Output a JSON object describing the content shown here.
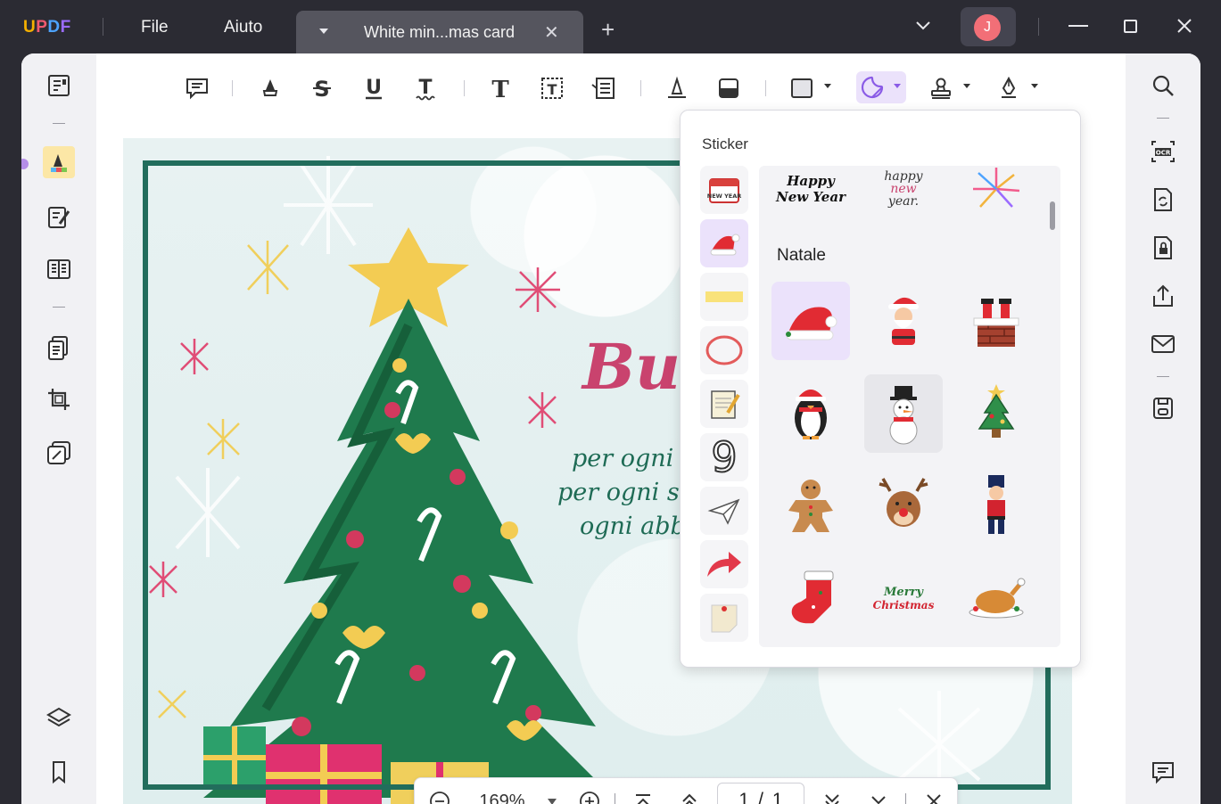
{
  "app": {
    "logo": [
      "U",
      "P",
      "D",
      "F"
    ],
    "logo_colors": [
      "#f5b000",
      "#ef5a6f",
      "#4da3ff",
      "#9b6bff"
    ],
    "menu": {
      "file": "File",
      "help": "Aiuto"
    },
    "tab": {
      "title": "White min...mas card",
      "close": "✕"
    },
    "new_tab": "+",
    "avatar_letter": "J",
    "window": {
      "dropdown": "⌄",
      "minimize": "—",
      "maximize": "☐",
      "close": "✕"
    }
  },
  "card": {
    "title_partial": "Bu",
    "lines": [
      "per ogni c",
      "per ogni son",
      "ogni abbr"
    ]
  },
  "zoom": {
    "value": "169%",
    "current_page": "1",
    "separator": "/",
    "total_pages": "1"
  },
  "sticker_panel": {
    "title": "Sticker",
    "section": "Natale",
    "top_row": [
      {
        "name": "happy-new-year-banner",
        "text_a": "Happy",
        "text_b": "New Year"
      },
      {
        "name": "happy-new-year-script",
        "text_a": "happy",
        "text_b": "new",
        "text_c": "year."
      },
      {
        "name": "fireworks"
      }
    ],
    "stickers": [
      "santa-hat",
      "santa-claus",
      "chimney-santa",
      "penguin",
      "snowman",
      "christmas-tree",
      "gingerbread-man",
      "reindeer",
      "nutcracker",
      "christmas-stocking",
      "merry-christmas",
      "roast-turkey"
    ],
    "merry_christmas_text": [
      "Merry",
      "Christmas"
    ],
    "categories": [
      "new-year",
      "christmas",
      "tape",
      "circle",
      "notepad",
      "number",
      "paper-plane",
      "arrow",
      "sticky-note"
    ],
    "new_year_cal": "NEW YEAR",
    "number_glyph": "9"
  },
  "colors": {
    "accent": "#9b6bff",
    "accent_bg": "#ebe2fb",
    "card_border": "#226d5c",
    "card_title": "#c9436e",
    "titlebar": "#2b2b33"
  }
}
